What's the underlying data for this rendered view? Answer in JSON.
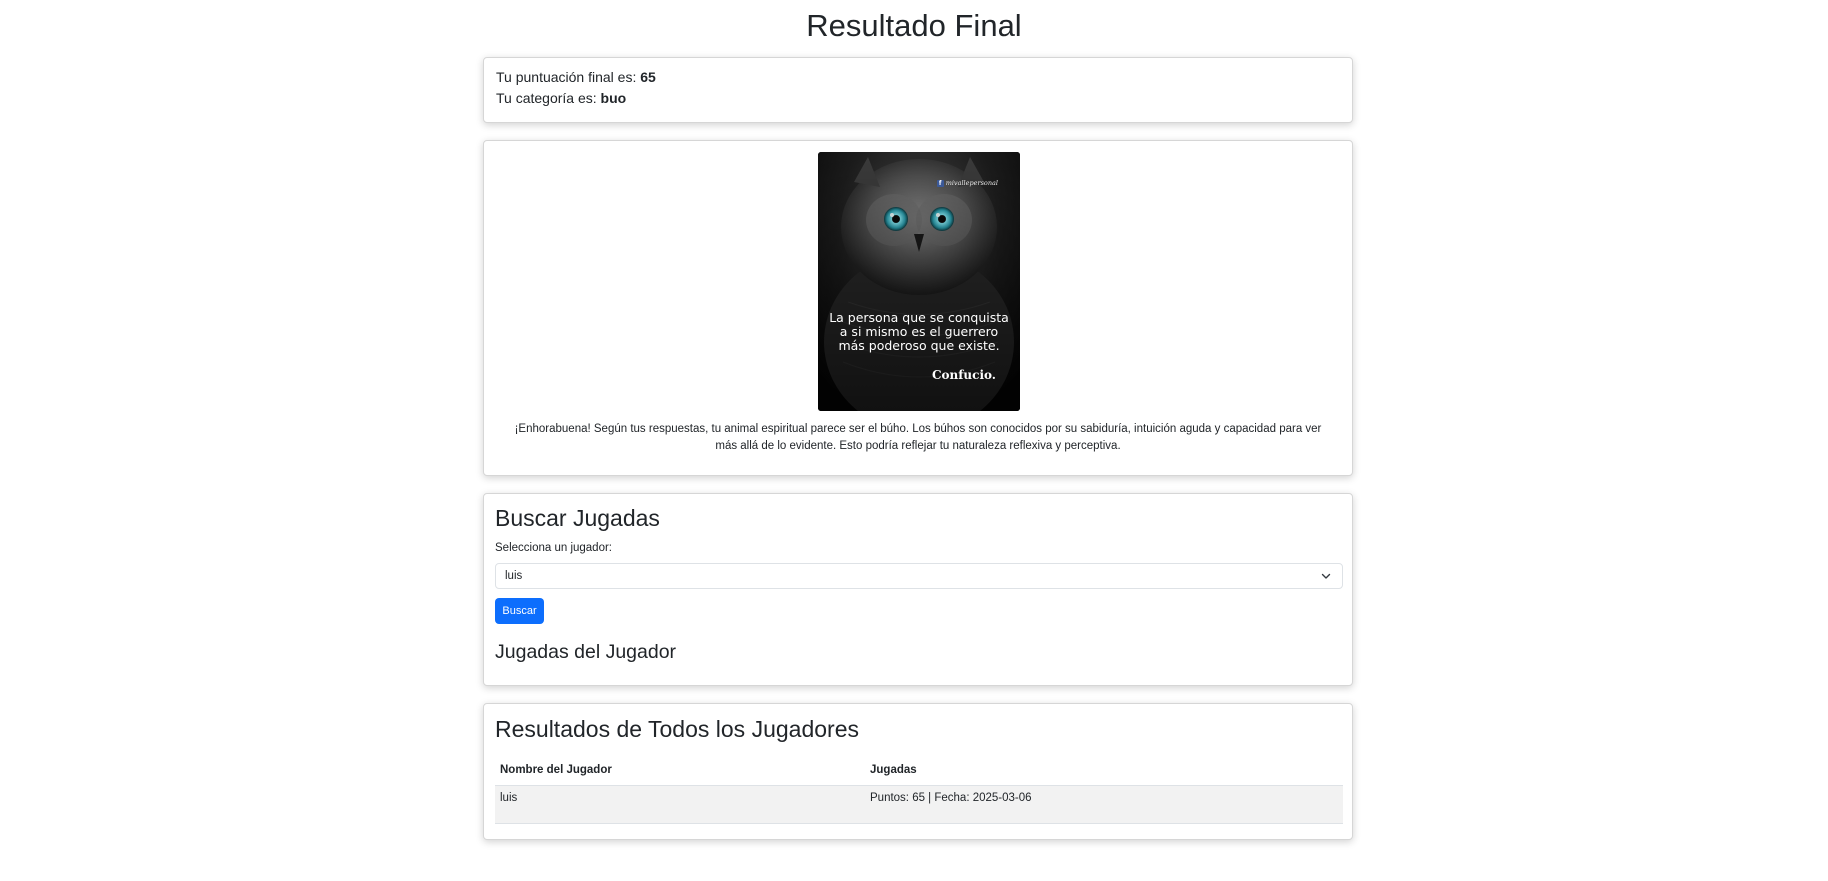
{
  "page": {
    "title": "Resultado Final"
  },
  "score": {
    "final_label": "Tu puntuación final es:",
    "final_value": "65",
    "category_label": "Tu categoría es:",
    "category_value": "buo"
  },
  "spirit": {
    "image": {
      "quote": "La persona que se conquista a si mismo es el guerrero más poderoso que existe.",
      "author": "Confucio.",
      "watermark": "mivallepersonal"
    },
    "description": "¡Enhorabuena! Según tus respuestas, tu animal espiritual parece ser el búho. Los búhos son conocidos por su sabiduría, intuición aguda y capacidad para ver más allá de lo evidente. Esto podría reflejar tu naturaleza reflexiva y perceptiva."
  },
  "search": {
    "title": "Buscar Jugadas",
    "select_label": "Selecciona un jugador:",
    "selected_player": "luis",
    "button_label": "Buscar",
    "plays_title": "Jugadas del Jugador"
  },
  "results": {
    "title": "Resultados de Todos los Jugadores",
    "columns": [
      "Nombre del Jugador",
      "Jugadas"
    ],
    "rows": [
      {
        "name": "luis",
        "plays": "Puntos: 65 | Fecha: 2025-03-06"
      }
    ]
  },
  "colors": {
    "primary_button": "#0d6efd",
    "owl_eye": "#3fb8c6",
    "row_stripe": "#f2f2f2"
  },
  "icons": {
    "select_arrow": "chevron-down-icon",
    "watermark_logo": "facebook-icon"
  }
}
